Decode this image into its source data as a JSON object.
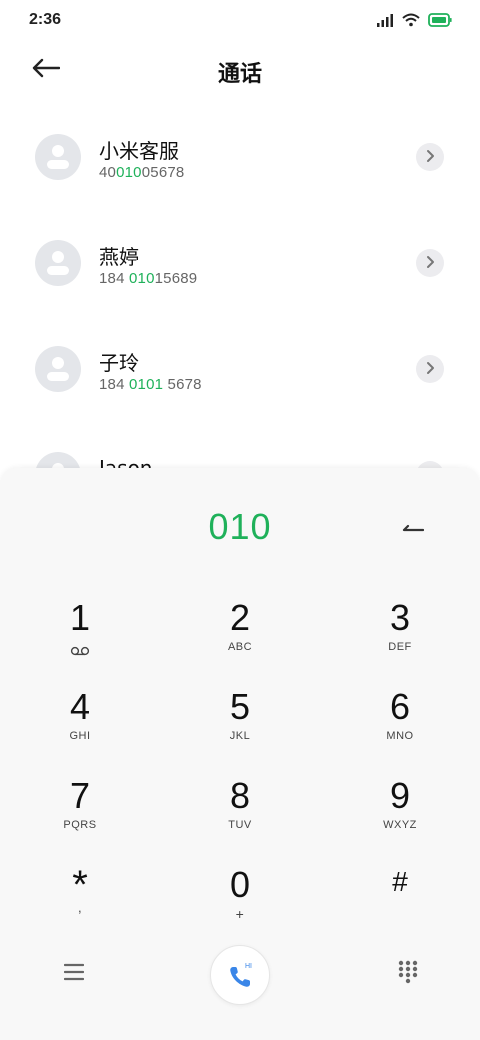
{
  "status_bar": {
    "time": "2:36",
    "battery_color": "#1fb15a"
  },
  "header": {
    "title": "通话",
    "back_icon": "back-arrow-icon"
  },
  "contacts": [
    {
      "name": "小米客服",
      "number_pre": "40",
      "number_match": "010",
      "number_post": "05678"
    },
    {
      "name": "燕婷",
      "number_pre": "184 ",
      "number_match": "010",
      "number_post": "15689"
    },
    {
      "name": "子玲",
      "number_pre": "184 ",
      "number_match": "0101",
      "number_post": " 5678"
    },
    {
      "name": "Jason",
      "number_pre": "",
      "number_match": "",
      "number_post": ""
    }
  ],
  "dialpad": {
    "display": "010",
    "keys": [
      {
        "digit": "1",
        "letters": "",
        "icon": "voicemail-icon"
      },
      {
        "digit": "2",
        "letters": "ABC"
      },
      {
        "digit": "3",
        "letters": "DEF"
      },
      {
        "digit": "4",
        "letters": "GHI"
      },
      {
        "digit": "5",
        "letters": "JKL"
      },
      {
        "digit": "6",
        "letters": "MNO"
      },
      {
        "digit": "7",
        "letters": "PQRS"
      },
      {
        "digit": "8",
        "letters": "TUV"
      },
      {
        "digit": "9",
        "letters": "WXYZ"
      },
      {
        "digit": "*",
        "letters": ","
      },
      {
        "digit": "0",
        "letters": "+"
      },
      {
        "digit": "#",
        "letters": ""
      }
    ],
    "call_badge": "HI"
  },
  "colors": {
    "accent": "#1fb15a",
    "call_icon": "#3a86e8"
  }
}
